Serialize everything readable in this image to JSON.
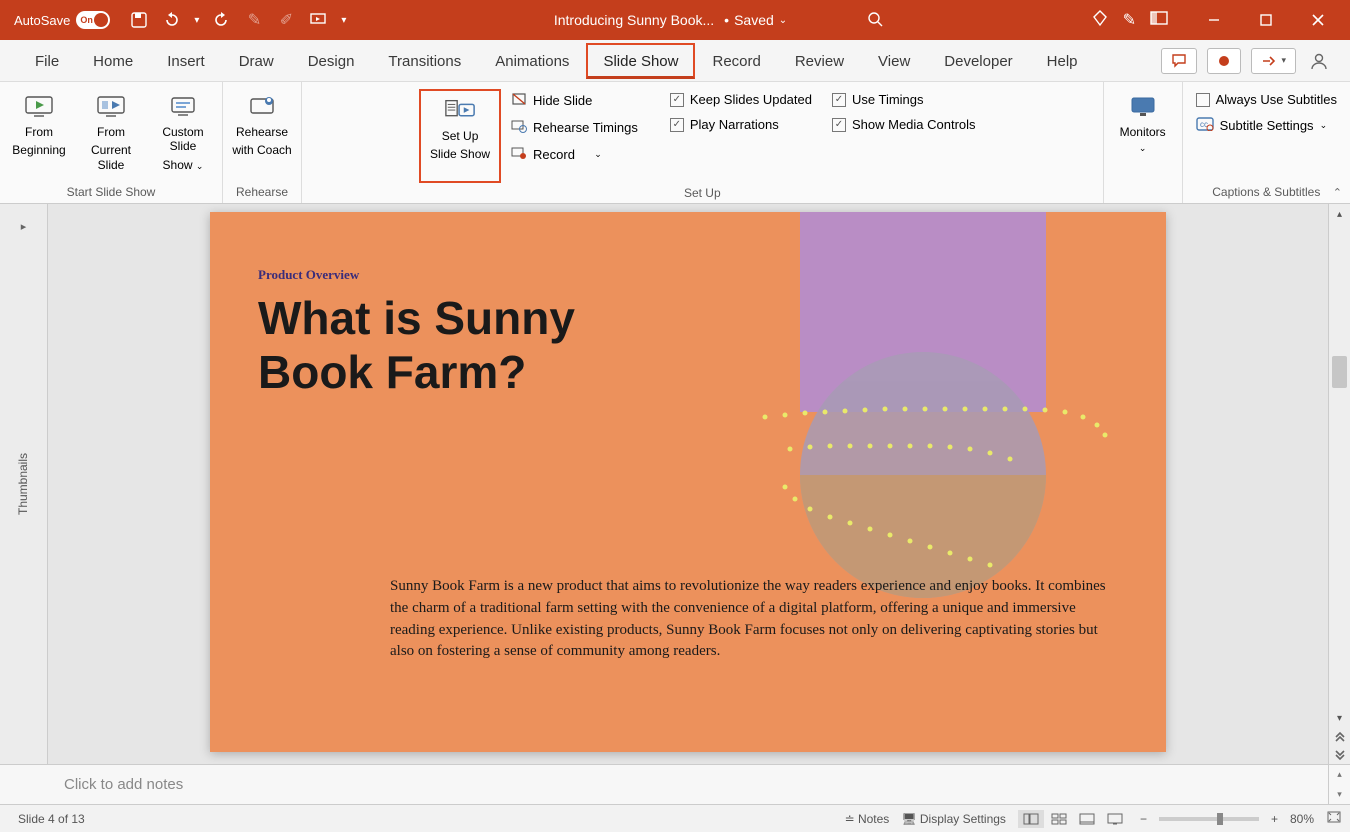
{
  "titlebar": {
    "autosave": "AutoSave",
    "toggle": "On",
    "doc_title": "Introducing Sunny Book...",
    "saved_label": "Saved"
  },
  "tabs": [
    "File",
    "Home",
    "Insert",
    "Draw",
    "Design",
    "Transitions",
    "Animations",
    "Slide Show",
    "Record",
    "Review",
    "View",
    "Developer",
    "Help"
  ],
  "active_tab": "Slide Show",
  "ribbon": {
    "group_start": "Start Slide Show",
    "from_beginning_l1": "From",
    "from_beginning_l2": "Beginning",
    "from_current_l1": "From",
    "from_current_l2": "Current Slide",
    "custom_l1": "Custom Slide",
    "custom_l2": "Show",
    "group_rehearse": "Rehearse",
    "rehearse_l1": "Rehearse",
    "rehearse_l2": "with Coach",
    "setup_l1": "Set Up",
    "setup_l2": "Slide Show",
    "hide_slide": "Hide Slide",
    "rehearse_timings": "Rehearse Timings",
    "record": "Record",
    "group_setup": "Set Up",
    "keep_updated": "Keep Slides Updated",
    "play_narr": "Play Narrations",
    "use_timings": "Use Timings",
    "show_media": "Show Media Controls",
    "monitors_l1": "Monitors",
    "always_sub": "Always Use Subtitles",
    "subtitle_settings": "Subtitle Settings",
    "group_captions": "Captions & Subtitles"
  },
  "thumbnails_label": "Thumbnails",
  "slide": {
    "subtitle": "Product Overview",
    "title_l1": "What is Sunny",
    "title_l2": "Book Farm?",
    "body": "Sunny Book Farm is a new product that aims to revolutionize the way readers experience and enjoy books. It combines the charm of a traditional farm setting with the convenience of a digital platform, offering a unique and immersive reading experience. Unlike existing products, Sunny Book Farm focuses not only on delivering captivating stories but also on fostering a sense of community among readers."
  },
  "notes_placeholder": "Click to add notes",
  "status": {
    "slide_counter": "Slide 4 of 13",
    "notes_btn": "Notes",
    "display_settings": "Display Settings",
    "zoom": "80%"
  }
}
